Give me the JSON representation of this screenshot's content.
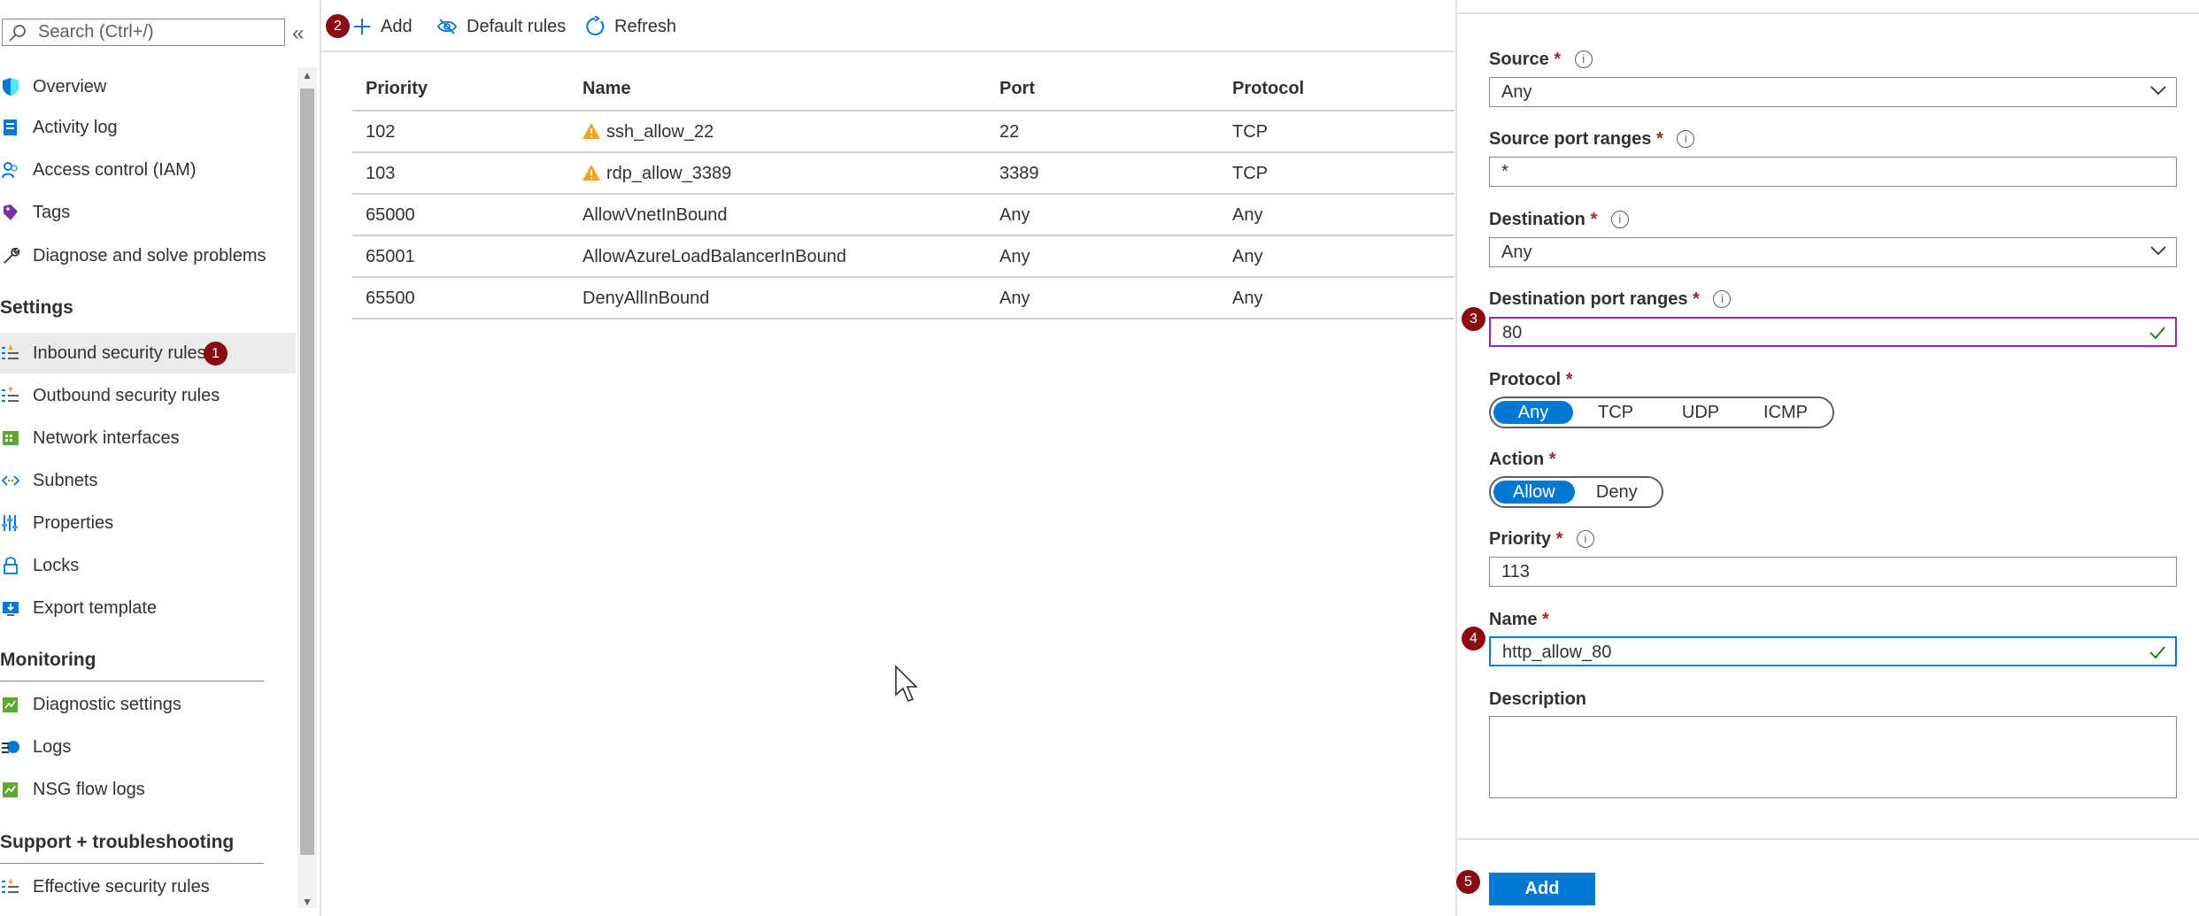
{
  "sidebar": {
    "search_placeholder": "Search (Ctrl+/)",
    "collapse_glyph": "«",
    "items_top": [
      {
        "label": "Overview",
        "icon": "shield-icon"
      },
      {
        "label": "Activity log",
        "icon": "activity-log-icon"
      },
      {
        "label": "Access control (IAM)",
        "icon": "people-icon"
      },
      {
        "label": "Tags",
        "icon": "tag-icon"
      },
      {
        "label": "Diagnose and solve problems",
        "icon": "wrench-icon"
      }
    ],
    "settings_title": "Settings",
    "settings_items": [
      {
        "label": "Inbound security rules",
        "icon": "inbound-rules-icon",
        "selected": true,
        "badge": "1"
      },
      {
        "label": "Outbound security rules",
        "icon": "outbound-rules-icon"
      },
      {
        "label": "Network interfaces",
        "icon": "network-interface-icon"
      },
      {
        "label": "Subnets",
        "icon": "subnet-icon"
      },
      {
        "label": "Properties",
        "icon": "properties-icon"
      },
      {
        "label": "Locks",
        "icon": "lock-icon"
      },
      {
        "label": "Export template",
        "icon": "export-template-icon"
      }
    ],
    "monitoring_title": "Monitoring",
    "monitoring_items": [
      {
        "label": "Diagnostic settings",
        "icon": "diagnostic-settings-icon"
      },
      {
        "label": "Logs",
        "icon": "logs-icon"
      },
      {
        "label": "NSG flow logs",
        "icon": "flow-logs-icon"
      }
    ],
    "support_title": "Support + troubleshooting",
    "support_items": [
      {
        "label": "Effective security rules",
        "icon": "effective-rules-icon"
      }
    ]
  },
  "toolbar": {
    "badge": "2",
    "add_label": "Add",
    "default_rules_label": "Default rules",
    "refresh_label": "Refresh"
  },
  "table": {
    "headers": [
      "Priority",
      "Name",
      "Port",
      "Protocol"
    ],
    "rows": [
      {
        "priority": "102",
        "name": "ssh_allow_22",
        "port": "22",
        "protocol": "TCP",
        "warning": true
      },
      {
        "priority": "103",
        "name": "rdp_allow_3389",
        "port": "3389",
        "protocol": "TCP",
        "warning": true
      },
      {
        "priority": "65000",
        "name": "AllowVnetInBound",
        "port": "Any",
        "protocol": "Any",
        "warning": false
      },
      {
        "priority": "65001",
        "name": "AllowAzureLoadBalancerInBound",
        "port": "Any",
        "protocol": "Any",
        "warning": false
      },
      {
        "priority": "65500",
        "name": "DenyAllInBound",
        "port": "Any",
        "protocol": "Any",
        "warning": false
      }
    ]
  },
  "panel": {
    "required_mark": "*",
    "info_glyph": "i",
    "source": {
      "label": "Source",
      "value": "Any"
    },
    "source_ports": {
      "label": "Source port ranges",
      "value": "*"
    },
    "destination": {
      "label": "Destination",
      "value": "Any"
    },
    "dest_ports": {
      "label": "Destination port ranges",
      "value": "80",
      "badge": "3"
    },
    "protocol": {
      "label": "Protocol",
      "options": [
        "Any",
        "TCP",
        "UDP",
        "ICMP"
      ],
      "selected": "Any"
    },
    "action": {
      "label": "Action",
      "options": [
        "Allow",
        "Deny"
      ],
      "selected": "Allow"
    },
    "priority": {
      "label": "Priority",
      "value": "113"
    },
    "name": {
      "label": "Name",
      "value": "http_allow_80",
      "badge": "4"
    },
    "description": {
      "label": "Description",
      "value": ""
    },
    "submit": {
      "label": "Add",
      "badge": "5"
    }
  },
  "colors": {
    "accent": "#0078d4",
    "badge": "#8b0b13",
    "warning": "#f7a21b",
    "valid_check": "#107c10",
    "focus_purple": "#8a2ba5"
  }
}
